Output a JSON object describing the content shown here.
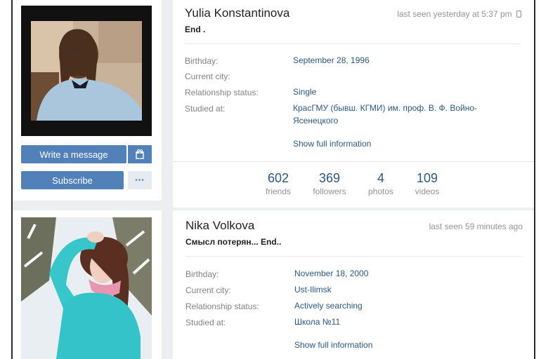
{
  "profiles": [
    {
      "name": "Yulia Konstantinova",
      "status": "End .",
      "last_seen": "last seen yesterday at 5:37 pm",
      "last_seen_icon": "phone-icon",
      "labels": {
        "birthday": "Birthday:",
        "city": "Current city:",
        "relationship": "Relationship status:",
        "studied": "Studied at:"
      },
      "birthday": "September 28, 1996",
      "city": "",
      "relationship": "Single",
      "studied": "КрасГМУ (бывш. КГМИ) им. проф. В. Ф. Войно-Ясенецкого",
      "show_full": "Show full information",
      "counters": [
        {
          "value": "602",
          "label": "friends"
        },
        {
          "value": "369",
          "label": "followers"
        },
        {
          "value": "4",
          "label": "photos"
        },
        {
          "value": "109",
          "label": "videos"
        }
      ],
      "actions": {
        "write_message": "Write a message",
        "subscribe": "Subscribe",
        "more": "•••",
        "gift_icon": "gift-icon"
      }
    },
    {
      "name": "Nika Volkova",
      "status": "Смысл потерян... End..",
      "last_seen": "last seen 59 minutes ago",
      "labels": {
        "birthday": "Birthday:",
        "city": "Current city:",
        "relationship": "Relationship status:",
        "studied": "Studied at:"
      },
      "birthday": "November 18, 2000",
      "city": "Ust-Ilimsk",
      "relationship": "Actively searching",
      "studied": "Школа №11",
      "show_full": "Show full information"
    }
  ],
  "colors": {
    "accent": "#5181b8",
    "link": "#2a5885",
    "muted": "#939393",
    "background": "#edeef0"
  }
}
